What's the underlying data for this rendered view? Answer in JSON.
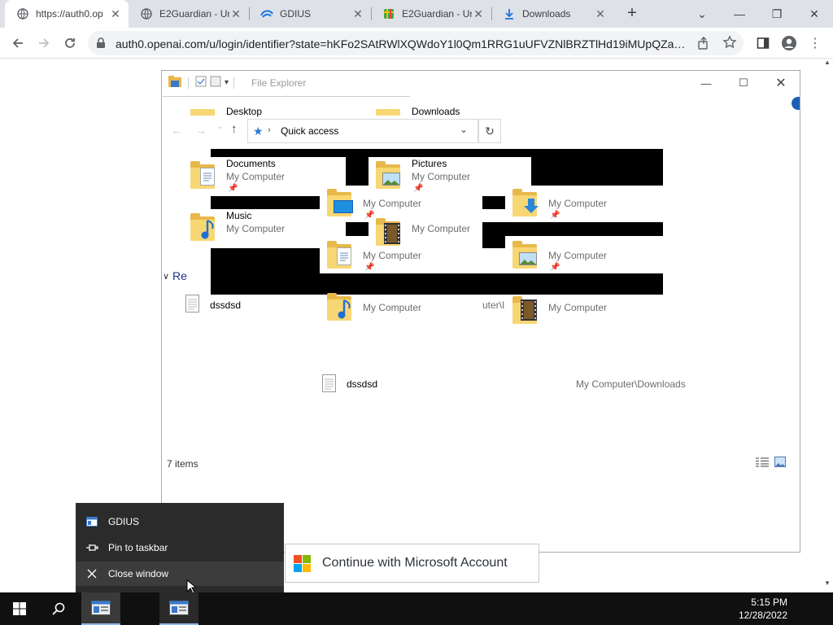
{
  "browser": {
    "tabs": [
      {
        "title": "https://auth0.op",
        "active": true
      },
      {
        "title": "E2Guardian - Ur",
        "active": false
      },
      {
        "title": "GDIUS",
        "active": false
      },
      {
        "title": "E2Guardian - Ur",
        "active": false
      },
      {
        "title": "Downloads",
        "active": false
      }
    ],
    "url": "auth0.openai.com/u/login/identifier?state=hKFo2SAtRWlXQWdoY1l0Qm1RRG1uUFVZNlBRZTlHd19iMUpQZaFur..."
  },
  "explorer": {
    "title": "File Explorer",
    "address": "Quick access",
    "status": "7 items",
    "recent_header": "Re",
    "partial_path": "uter\\I",
    "items": {
      "desktop": "Desktop",
      "downloads": "Downloads",
      "documents": "Documents",
      "pictures": "Pictures",
      "music": "Music",
      "my_computer": "My Computer",
      "recent_file_1": "dssdsd",
      "recent_file_2": "dssdsd",
      "recent_file_2_path": "My Computer\\Downloads"
    }
  },
  "context_menu": {
    "app": "GDIUS",
    "pin": "Pin to taskbar",
    "close": "Close window"
  },
  "ms_button": {
    "label": "Continue with Microsoft Account"
  },
  "taskbar": {
    "time": "5:15 PM",
    "date": "12/28/2022"
  },
  "colors": {
    "tabstrip": "#dee1e6",
    "taskbar": "#101010",
    "folder": "#f7d774"
  }
}
